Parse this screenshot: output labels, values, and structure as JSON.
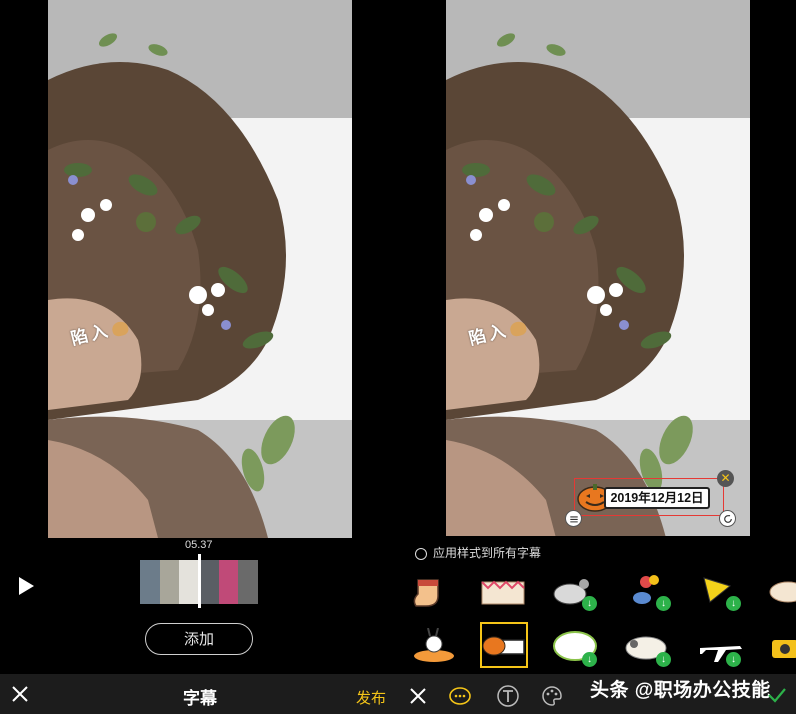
{
  "left": {
    "photo_text": "陷入",
    "time": "05.37",
    "add_label": "添加",
    "title": "字幕",
    "publish_label": "发布"
  },
  "right": {
    "caption_date": "2019年12月12日",
    "apply_all_label": "应用样式到所有字幕",
    "watermark": "头条 @职场办公技能"
  },
  "colors": {
    "accent": "#f5c518",
    "selection_border": "#e53935",
    "download_badge": "#2db24a",
    "bar_bg": "#1c1c1c"
  },
  "icons": [
    "play-icon",
    "close-icon",
    "emoji-icon",
    "text-style-icon",
    "palette-icon",
    "check-icon",
    "download-icon"
  ]
}
